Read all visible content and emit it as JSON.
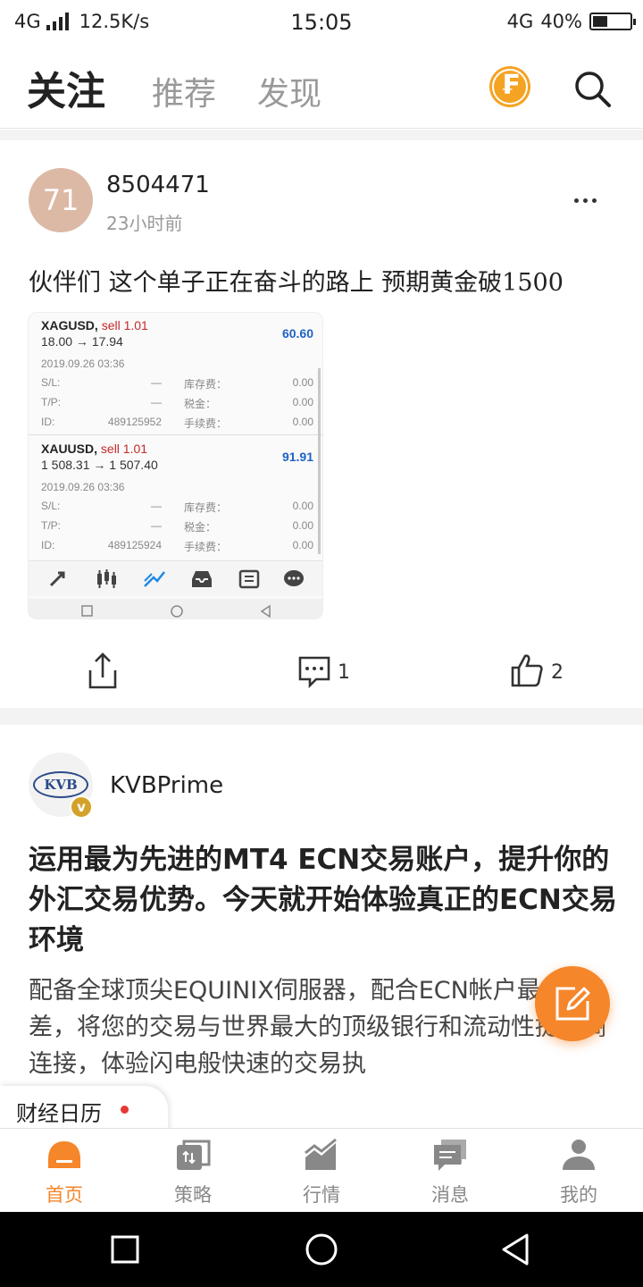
{
  "status_bar": {
    "network": "4G",
    "speed": "12.5K/s",
    "time": "15:05",
    "network_right": "4G",
    "battery": "40%",
    "battery_level": 0.4
  },
  "top_nav": {
    "tabs": [
      "关注",
      "推荐",
      "发现"
    ],
    "active_tab": "关注",
    "coin_symbol": "₣"
  },
  "post1": {
    "avatar_text": "71",
    "username": "8504471",
    "time": "23小时前",
    "text": "伙伴们 这个单子正在奋斗的路上 预期黄金破1500",
    "screenshot": {
      "orders": [
        {
          "symbol": "XAGUSD,",
          "direction": "sell 1.01",
          "prices": "18.00 → 17.94",
          "profit": "60.60",
          "datetime": "2019.09.26 03:36",
          "sl_label": "S/L:",
          "sl_value": "—",
          "tp_label": "T/P:",
          "tp_value": "—",
          "id_label": "ID:",
          "id_value": "489125952",
          "swap_label": "库存费：",
          "swap_value": "0.00",
          "tax_label": "税金：",
          "tax_value": "0.00",
          "fee_label": "手续费：",
          "fee_value": "0.00"
        },
        {
          "symbol": "XAUUSD,",
          "direction": "sell 1.01",
          "prices": "1 508.31 → 1 507.40",
          "profit": "91.91",
          "datetime": "2019.09.26 03:36",
          "sl_label": "S/L:",
          "sl_value": "—",
          "tp_label": "T/P:",
          "tp_value": "—",
          "id_label": "ID:",
          "id_value": "489125924",
          "swap_label": "库存费：",
          "swap_value": "0.00",
          "tax_label": "税金：",
          "tax_value": "0.00",
          "fee_label": "手续费：",
          "fee_value": "0.00"
        }
      ]
    },
    "comment_count": "1",
    "like_count": "2"
  },
  "post2": {
    "logo_text": "KVB",
    "verified_badge": "v",
    "username": "KVBPrime",
    "headline": "运用最为先进的MT4 ECN交易账户，提升你的外汇交易优势。今天就开始体验真正的ECN交易环境",
    "summary": "配备全球顶尖EQUINIX伺服器，配合ECN帐户最低0点差，将您的交易与世界最大的顶级银行和流动性提供商连接，体验闪电般快速的交易执"
  },
  "calendar": {
    "label": "财经日历"
  },
  "bottom_tabs": [
    {
      "label": "首页",
      "icon": "home-icon",
      "active": true
    },
    {
      "label": "策略",
      "icon": "strategy-icon",
      "active": false
    },
    {
      "label": "行情",
      "icon": "market-chart-icon",
      "active": false
    },
    {
      "label": "消息",
      "icon": "message-icon",
      "active": false
    },
    {
      "label": "我的",
      "icon": "profile-icon",
      "active": false
    }
  ],
  "colors": {
    "accent": "#f5862a",
    "coin": "#f5a323",
    "profit_blue": "#1e63c4",
    "sell_red": "#c62828"
  }
}
